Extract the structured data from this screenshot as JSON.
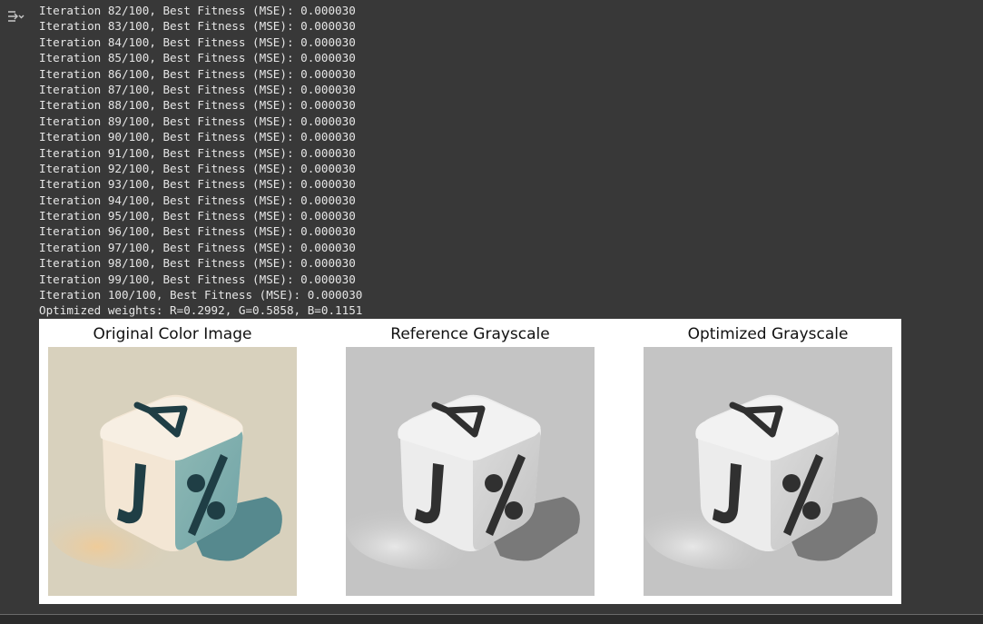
{
  "output_toggle": {
    "icon": "output-collapse-icon"
  },
  "log_lines": [
    "Iteration 82/100, Best Fitness (MSE): 0.000030",
    "Iteration 83/100, Best Fitness (MSE): 0.000030",
    "Iteration 84/100, Best Fitness (MSE): 0.000030",
    "Iteration 85/100, Best Fitness (MSE): 0.000030",
    "Iteration 86/100, Best Fitness (MSE): 0.000030",
    "Iteration 87/100, Best Fitness (MSE): 0.000030",
    "Iteration 88/100, Best Fitness (MSE): 0.000030",
    "Iteration 89/100, Best Fitness (MSE): 0.000030",
    "Iteration 90/100, Best Fitness (MSE): 0.000030",
    "Iteration 91/100, Best Fitness (MSE): 0.000030",
    "Iteration 92/100, Best Fitness (MSE): 0.000030",
    "Iteration 93/100, Best Fitness (MSE): 0.000030",
    "Iteration 94/100, Best Fitness (MSE): 0.000030",
    "Iteration 95/100, Best Fitness (MSE): 0.000030",
    "Iteration 96/100, Best Fitness (MSE): 0.000030",
    "Iteration 97/100, Best Fitness (MSE): 0.000030",
    "Iteration 98/100, Best Fitness (MSE): 0.000030",
    "Iteration 99/100, Best Fitness (MSE): 0.000030",
    "Iteration 100/100, Best Fitness (MSE): 0.000030",
    "Optimized weights: R=0.2992, G=0.5858, B=0.1151"
  ],
  "figure": {
    "panels": [
      {
        "title": "Original Color Image",
        "variant": "color"
      },
      {
        "title": "Reference Grayscale",
        "variant": "gray"
      },
      {
        "title": "Optimized Grayscale",
        "variant": "gray"
      }
    ]
  },
  "colors": {
    "page_bg": "#383838",
    "text": "#e6e6e6",
    "color_bg": "#d8d1bd",
    "color_cube": "#f7efe3",
    "color_side": "#8fb9b5",
    "color_glyph": "#1f3e45",
    "gray_bg": "#c4c4c4",
    "gray_cube": "#f2f2f2",
    "gray_side": "#dcdcdc",
    "gray_glyph": "#303030"
  }
}
